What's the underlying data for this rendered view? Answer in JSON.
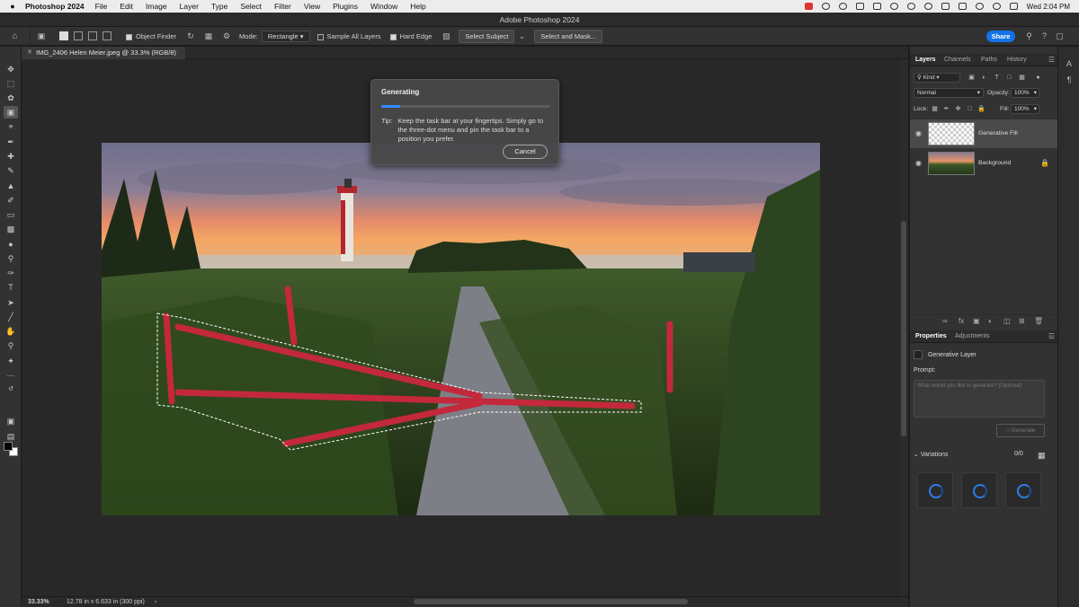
{
  "menubar": {
    "app_name": "Photoshop 2024",
    "items": [
      "File",
      "Edit",
      "Image",
      "Layer",
      "Type",
      "Select",
      "Filter",
      "View",
      "Plugins",
      "Window",
      "Help"
    ],
    "clock": "Wed 2:04 PM"
  },
  "window": {
    "title": "Adobe Photoshop 2024"
  },
  "options_bar": {
    "object_finder": "Object Finder",
    "mode_label": "Mode:",
    "mode_value": "Rectangle",
    "sample_all_layers": "Sample All Layers",
    "hard_edge": "Hard Edge",
    "select_subject": "Select Subject",
    "select_and_mask": "Select and Mask...",
    "share": "Share"
  },
  "document": {
    "tab_title": "IMG_2406 Helen Meier.jpeg @ 33.3% (RGB/8)"
  },
  "dialog": {
    "title": "Generating",
    "progress": 0.11,
    "tip_key": "Tip:",
    "tip_text": "Keep the task bar at your fingertips. Simply go to the three-dot menu and pin the task bar to a position you prefer.",
    "cancel": "Cancel"
  },
  "status": {
    "zoom": "33.33%",
    "dimensions": "12.78 in x 6.633 in (300 ppi)",
    "arrow": "›"
  },
  "layers_panel": {
    "tabs": [
      "Layers",
      "Channels",
      "Paths",
      "History"
    ],
    "kind": "Kind",
    "blend_mode": "Normal",
    "opacity_label": "Opacity:",
    "opacity_value": "100%",
    "lock_label": "Lock:",
    "fill_label": "Fill:",
    "fill_value": "100%",
    "layers": [
      {
        "name": "Generative Fill",
        "selected": true
      },
      {
        "name": "Background",
        "locked": true
      }
    ]
  },
  "properties_panel": {
    "tabs": [
      "Properties",
      "Adjustments"
    ],
    "layer_type": "Generative Layer",
    "prompt_label": "Prompt:",
    "prompt_placeholder": "What would you like to generate? (Optional)",
    "generate": "Generate",
    "variations_label": "Variations",
    "variations_count": "0/0"
  },
  "colors": {
    "accent": "#1473e6",
    "progress": "#2f8cff",
    "panel_bg": "#323232",
    "canvas_bg": "#282828"
  }
}
